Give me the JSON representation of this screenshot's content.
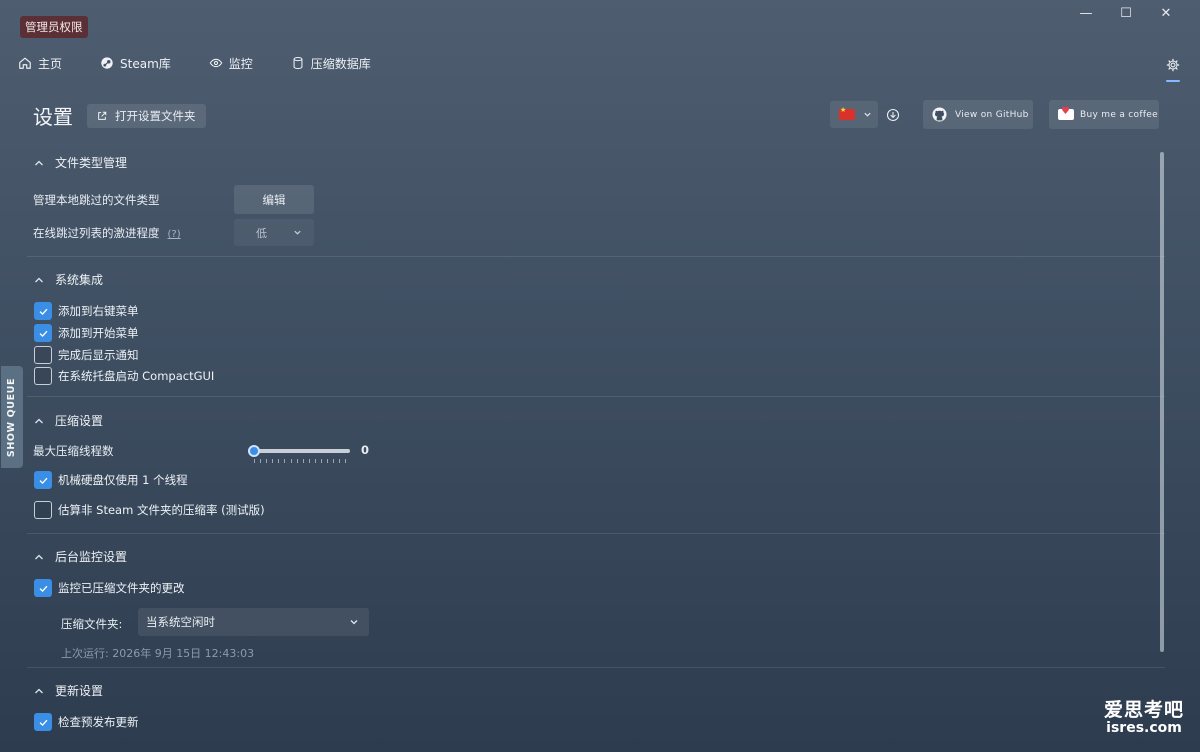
{
  "titlebar": {
    "admin_badge": "管理员权限",
    "minimize": "—",
    "maximize": "☐",
    "close": "✕"
  },
  "nav": {
    "items": [
      {
        "label": "主页",
        "icon": "home-icon"
      },
      {
        "label": "Steam库",
        "icon": "steam-icon"
      },
      {
        "label": "监控",
        "icon": "eye-icon"
      },
      {
        "label": "压缩数据库",
        "icon": "database-icon"
      }
    ],
    "settings_icon": "gear-icon"
  },
  "header": {
    "title": "设置",
    "open_folder_label": "打开设置文件夹",
    "language_flag": "china-flag",
    "github_label": "View on GitHub",
    "coffee_label": "Buy me a coffee"
  },
  "sections": {
    "file_types": {
      "title": "文件类型管理",
      "skip_label": "管理本地跳过的文件类型",
      "edit_label": "编辑",
      "aggressiveness_label": "在线跳过列表的激进程度",
      "help_mark": "(?)",
      "aggressiveness_value": "低"
    },
    "system": {
      "title": "系统集成",
      "options": [
        {
          "label": "添加到右键菜单",
          "checked": true
        },
        {
          "label": "添加到开始菜单",
          "checked": true
        },
        {
          "label": "完成后显示通知",
          "checked": false
        },
        {
          "label": "在系统托盘启动 CompactGUI",
          "checked": false
        }
      ]
    },
    "compression": {
      "title": "压缩设置",
      "threads_label": "最大压缩线程数",
      "threads_value": "0",
      "hdd_label": "机械硬盘仅使用 1 个线程",
      "hdd_checked": true,
      "estimate_label": "估算非 Steam 文件夹的压缩率 (测试版)",
      "estimate_checked": false
    },
    "monitor": {
      "title": "后台监控设置",
      "watch_label": "监控已压缩文件夹的更改",
      "watch_checked": true,
      "compress_label": "压缩文件夹:",
      "compress_value": "当系统空闲时",
      "last_run": "上次运行: 2026年 9月 15日 12:43:03"
    },
    "updates": {
      "title": "更新设置",
      "prerelease_label": "检查预发布更新",
      "prerelease_checked": true
    }
  },
  "queue_tab": "SHOW QUEUE",
  "watermark": {
    "cn": "爱思考吧",
    "url": "isres.com"
  },
  "colors": {
    "accent": "#3a8ee6",
    "admin_badge_bg": "#5a3036"
  }
}
